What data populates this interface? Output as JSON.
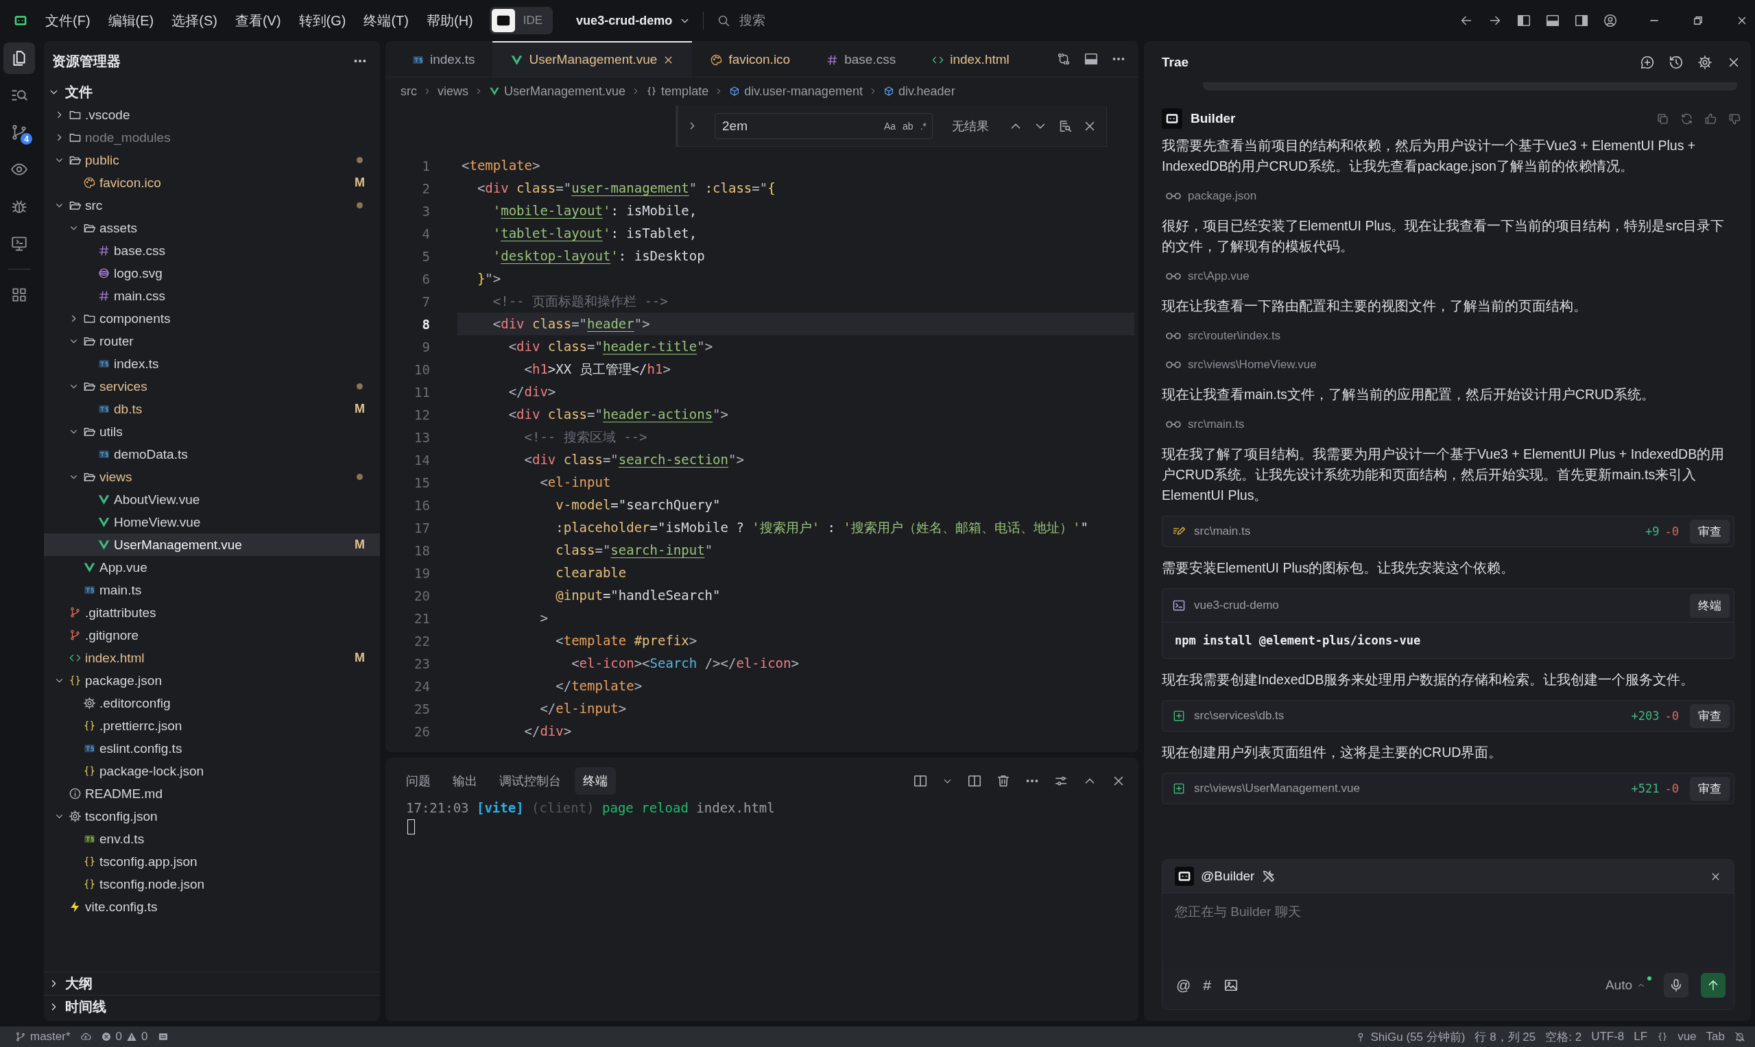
{
  "title_bar": {
    "menus": [
      "文件(F)",
      "编辑(E)",
      "选择(S)",
      "查看(V)",
      "转到(G)",
      "终端(T)",
      "帮助(H)"
    ],
    "mode_switch": [
      {
        "kind": "builder",
        "selected": true
      },
      {
        "kind": "text",
        "label": "IDE",
        "selected": false
      }
    ],
    "project": "vue3-crud-demo",
    "search": {
      "placeholder": "搜索"
    }
  },
  "activity_bar": {
    "items": [
      {
        "kind": "files",
        "selected": true
      },
      {
        "kind": "search",
        "selected": false
      },
      {
        "kind": "source-control",
        "selected": false,
        "badge": "4"
      },
      {
        "kind": "eye",
        "selected": false
      },
      {
        "kind": "debug",
        "selected": false
      },
      {
        "kind": "remote",
        "selected": false
      }
    ],
    "extensions": [
      {
        "kind": "extensions",
        "selected": false
      }
    ]
  },
  "explorer": {
    "title": "资源管理器",
    "section": {
      "title": "文件",
      "expanded": true
    },
    "tree": [
      {
        "name": ".vscode",
        "kind": "folder",
        "expanded": false,
        "selected": false
      },
      {
        "name": "node_modules",
        "kind": "folder",
        "expanded": false,
        "selected": false,
        "ignored": true
      },
      {
        "name": "public",
        "kind": "folder",
        "expanded": true,
        "selected": false,
        "modified": true,
        "changed": true,
        "children": [
          {
            "name": "favicon.ico",
            "kind": "image",
            "selected": false,
            "modified": true,
            "status": "M"
          }
        ]
      },
      {
        "name": "src",
        "kind": "folder",
        "expanded": true,
        "selected": false,
        "changed": true,
        "children": [
          {
            "name": "assets",
            "kind": "folder",
            "expanded": true,
            "selected": false,
            "children": [
              {
                "name": "base.css",
                "kind": "css",
                "selected": false
              },
              {
                "name": "logo.svg",
                "kind": "svg",
                "selected": false
              },
              {
                "name": "main.css",
                "kind": "css",
                "selected": false
              }
            ]
          },
          {
            "name": "components",
            "kind": "folder",
            "expanded": false,
            "selected": false
          },
          {
            "name": "router",
            "kind": "folder",
            "expanded": true,
            "selected": false,
            "children": [
              {
                "name": "index.ts",
                "kind": "ts",
                "selected": false
              }
            ]
          },
          {
            "name": "services",
            "kind": "folder",
            "expanded": true,
            "selected": false,
            "modified": true,
            "changed": true,
            "children": [
              {
                "name": "db.ts",
                "kind": "ts",
                "selected": false,
                "modified": true,
                "status": "M"
              }
            ]
          },
          {
            "name": "utils",
            "kind": "folder",
            "expanded": true,
            "selected": false,
            "children": [
              {
                "name": "demoData.ts",
                "kind": "ts",
                "selected": false
              }
            ]
          },
          {
            "name": "views",
            "kind": "folder",
            "expanded": true,
            "selected": false,
            "modified": true,
            "changed": true,
            "children": [
              {
                "name": "AboutView.vue",
                "kind": "vue",
                "selected": false
              },
              {
                "name": "HomeView.vue",
                "kind": "vue",
                "selected": false
              },
              {
                "name": "UserManagement.vue",
                "kind": "vue",
                "selected": true,
                "modified": true,
                "status": "M"
              }
            ]
          },
          {
            "name": "App.vue",
            "kind": "vue",
            "selected": false
          },
          {
            "name": "main.ts",
            "kind": "ts",
            "selected": false
          }
        ]
      },
      {
        "name": ".gitattributes",
        "kind": "git",
        "selected": false
      },
      {
        "name": ".gitignore",
        "kind": "git",
        "selected": false
      },
      {
        "name": "index.html",
        "kind": "html",
        "selected": false,
        "modified": true,
        "status": "M"
      },
      {
        "name": "package.json",
        "kind": "json",
        "expanded": true,
        "selected": false,
        "children": [
          {
            "name": ".editorconfig",
            "kind": "gear",
            "selected": false
          },
          {
            "name": ".prettierrc.json",
            "kind": "json",
            "selected": false
          },
          {
            "name": "eslint.config.ts",
            "kind": "ts",
            "selected": false
          },
          {
            "name": "package-lock.json",
            "kind": "json",
            "selected": false
          }
        ]
      },
      {
        "name": "README.md",
        "kind": "info",
        "selected": false
      },
      {
        "name": "tsconfig.json",
        "kind": "gear",
        "expanded": true,
        "selected": false,
        "children": [
          {
            "name": "env.d.ts",
            "kind": "dts",
            "selected": false
          },
          {
            "name": "tsconfig.app.json",
            "kind": "json",
            "selected": false
          },
          {
            "name": "tsconfig.node.json",
            "kind": "json",
            "selected": false
          }
        ]
      },
      {
        "name": "vite.config.ts",
        "kind": "bolt",
        "selected": false
      }
    ],
    "collapsed_sections": [
      {
        "title": "大纲",
        "expanded": false
      },
      {
        "title": "时间线",
        "expanded": false
      }
    ]
  },
  "editor": {
    "tabs": [
      {
        "label": "index.ts",
        "kind": "ts",
        "modified": false,
        "selected": false
      },
      {
        "label": "UserManagement.vue",
        "kind": "vue",
        "modified": true,
        "selected": true
      },
      {
        "label": "favicon.ico",
        "kind": "image",
        "modified": true,
        "selected": false
      },
      {
        "label": "base.css",
        "kind": "css",
        "modified": false,
        "selected": false
      },
      {
        "label": "index.html",
        "kind": "html",
        "modified": true,
        "selected": false
      }
    ],
    "breadcrumb": [
      {
        "label": "src",
        "kind": "plain"
      },
      {
        "label": "views",
        "kind": "plain"
      },
      {
        "label": "UserManagement.vue",
        "kind": "vue"
      },
      {
        "label": "template",
        "kind": "braces"
      },
      {
        "label": "div.user-management",
        "kind": "element"
      },
      {
        "label": "div.header",
        "kind": "element"
      }
    ],
    "find": {
      "value": "2em",
      "options": [
        "Aa",
        "ab",
        ".*"
      ],
      "result": "无结果"
    },
    "lines": [
      {
        "n": "1",
        "current": false,
        "code": [
          {
            "text": "<",
            "kind": "p"
          },
          {
            "text": "template",
            "kind": "tag2"
          },
          {
            "text": ">",
            "kind": "p"
          }
        ]
      },
      {
        "n": "2",
        "current": false,
        "code": [
          {
            "text": "  <",
            "kind": "p"
          },
          {
            "text": "div",
            "kind": "tag"
          },
          {
            "text": " class",
            "kind": "attr"
          },
          {
            "text": "=\"",
            "kind": "p"
          },
          {
            "text": "user-management",
            "kind": "link"
          },
          {
            "text": "\" ",
            "kind": "p"
          },
          {
            "text": ":class",
            "kind": "attr"
          },
          {
            "text": "=\"",
            "kind": "p"
          },
          {
            "text": "{",
            "kind": "brace"
          }
        ]
      },
      {
        "n": "3",
        "current": false,
        "code": [
          {
            "text": "    '",
            "kind": "str"
          },
          {
            "text": "mobile-layout",
            "kind": "link"
          },
          {
            "text": "'",
            "kind": "str"
          },
          {
            "text": ": isMobile,",
            "kind": "plain"
          }
        ]
      },
      {
        "n": "4",
        "current": false,
        "code": [
          {
            "text": "    '",
            "kind": "str"
          },
          {
            "text": "tablet-layout",
            "kind": "link"
          },
          {
            "text": "'",
            "kind": "str"
          },
          {
            "text": ": isTablet,",
            "kind": "plain"
          }
        ]
      },
      {
        "n": "5",
        "current": false,
        "code": [
          {
            "text": "    '",
            "kind": "str"
          },
          {
            "text": "desktop-layout",
            "kind": "link"
          },
          {
            "text": "'",
            "kind": "str"
          },
          {
            "text": ": isDesktop",
            "kind": "plain"
          }
        ]
      },
      {
        "n": "6",
        "current": false,
        "code": [
          {
            "text": "  }",
            "kind": "brace"
          },
          {
            "text": "\">",
            "kind": "p"
          }
        ]
      },
      {
        "n": "7",
        "current": false,
        "code": [
          {
            "text": "    <!-- 页面标题和操作栏 -->",
            "kind": "comment"
          }
        ]
      },
      {
        "n": "8",
        "current": true,
        "code": [
          {
            "text": "    <",
            "kind": "p"
          },
          {
            "text": "div",
            "kind": "tag"
          },
          {
            "text": " class",
            "kind": "attr"
          },
          {
            "text": "=\"",
            "kind": "p"
          },
          {
            "text": "header",
            "kind": "link"
          },
          {
            "text": "\">",
            "kind": "p"
          }
        ]
      },
      {
        "n": "9",
        "current": false,
        "code": [
          {
            "text": "      <",
            "kind": "p"
          },
          {
            "text": "div",
            "kind": "tag"
          },
          {
            "text": " class",
            "kind": "attr"
          },
          {
            "text": "=\"",
            "kind": "p"
          },
          {
            "text": "header-title",
            "kind": "link"
          },
          {
            "text": "\">",
            "kind": "p"
          }
        ]
      },
      {
        "n": "10",
        "current": false,
        "code": [
          {
            "text": "        <",
            "kind": "p"
          },
          {
            "text": "h1",
            "kind": "tag"
          },
          {
            "text": ">XX 员工管理</",
            "kind": "plain"
          },
          {
            "text": "h1",
            "kind": "tag"
          },
          {
            "text": ">",
            "kind": "p"
          }
        ]
      },
      {
        "n": "11",
        "current": false,
        "code": [
          {
            "text": "      </",
            "kind": "p"
          },
          {
            "text": "div",
            "kind": "tag"
          },
          {
            "text": ">",
            "kind": "p"
          }
        ]
      },
      {
        "n": "12",
        "current": false,
        "code": [
          {
            "text": "      <",
            "kind": "p"
          },
          {
            "text": "div",
            "kind": "tag"
          },
          {
            "text": " class",
            "kind": "attr"
          },
          {
            "text": "=\"",
            "kind": "p"
          },
          {
            "text": "header-actions",
            "kind": "link"
          },
          {
            "text": "\">",
            "kind": "p"
          }
        ]
      },
      {
        "n": "13",
        "current": false,
        "code": [
          {
            "text": "        <!-- 搜索区域 -->",
            "kind": "comment"
          }
        ]
      },
      {
        "n": "14",
        "current": false,
        "code": [
          {
            "text": "        <",
            "kind": "p"
          },
          {
            "text": "div",
            "kind": "tag"
          },
          {
            "text": " class",
            "kind": "attr"
          },
          {
            "text": "=\"",
            "kind": "p"
          },
          {
            "text": "search-section",
            "kind": "link"
          },
          {
            "text": "\">",
            "kind": "p"
          }
        ]
      },
      {
        "n": "15",
        "current": false,
        "code": [
          {
            "text": "          <",
            "kind": "p"
          },
          {
            "text": "el-input",
            "kind": "tag2"
          }
        ]
      },
      {
        "n": "16",
        "current": false,
        "code": [
          {
            "text": "            v-model",
            "kind": "attr"
          },
          {
            "text": "=\"searchQuery\"",
            "kind": "plain"
          }
        ]
      },
      {
        "n": "17",
        "current": false,
        "code": [
          {
            "text": "            :placeholder",
            "kind": "attr"
          },
          {
            "text": "=\"isMobile ? ",
            "kind": "plain"
          },
          {
            "text": "'搜索用户'",
            "kind": "str"
          },
          {
            "text": " : ",
            "kind": "plain"
          },
          {
            "text": "'搜索用户（姓名、邮箱、电话、地址）'",
            "kind": "str"
          },
          {
            "text": "\"",
            "kind": "plain"
          }
        ]
      },
      {
        "n": "18",
        "current": false,
        "code": [
          {
            "text": "            class",
            "kind": "attr"
          },
          {
            "text": "=\"",
            "kind": "p"
          },
          {
            "text": "search-input",
            "kind": "link"
          },
          {
            "text": "\"",
            "kind": "p"
          }
        ]
      },
      {
        "n": "19",
        "current": false,
        "code": [
          {
            "text": "            clearable",
            "kind": "attr"
          }
        ]
      },
      {
        "n": "20",
        "current": false,
        "code": [
          {
            "text": "            @input",
            "kind": "attr"
          },
          {
            "text": "=\"handleSearch\"",
            "kind": "plain"
          }
        ]
      },
      {
        "n": "21",
        "current": false,
        "code": [
          {
            "text": "          >",
            "kind": "p"
          }
        ]
      },
      {
        "n": "22",
        "current": false,
        "code": [
          {
            "text": "            <",
            "kind": "p"
          },
          {
            "text": "template",
            "kind": "tag2"
          },
          {
            "text": " #prefix",
            "kind": "attr"
          },
          {
            "text": ">",
            "kind": "p"
          }
        ]
      },
      {
        "n": "23",
        "current": false,
        "code": [
          {
            "text": "              <",
            "kind": "p"
          },
          {
            "text": "el-icon",
            "kind": "tag"
          },
          {
            "text": "><",
            "kind": "p"
          },
          {
            "text": "Search",
            "kind": "comp"
          },
          {
            "text": " /></",
            "kind": "p"
          },
          {
            "text": "el-icon",
            "kind": "tag"
          },
          {
            "text": ">",
            "kind": "p"
          }
        ]
      },
      {
        "n": "24",
        "current": false,
        "code": [
          {
            "text": "            </",
            "kind": "p"
          },
          {
            "text": "template",
            "kind": "tag2"
          },
          {
            "text": ">",
            "kind": "p"
          }
        ]
      },
      {
        "n": "25",
        "current": false,
        "code": [
          {
            "text": "          </",
            "kind": "p"
          },
          {
            "text": "el-input",
            "kind": "tag2"
          },
          {
            "text": ">",
            "kind": "p"
          }
        ]
      },
      {
        "n": "26",
        "current": false,
        "code": [
          {
            "text": "        </",
            "kind": "p"
          },
          {
            "text": "div",
            "kind": "tag"
          },
          {
            "text": ">",
            "kind": "p"
          }
        ]
      }
    ]
  },
  "terminal": {
    "tabs": [
      {
        "label": "问题",
        "selected": false
      },
      {
        "label": "输出",
        "selected": false
      },
      {
        "label": "调试控制台",
        "selected": false
      },
      {
        "label": "终端",
        "selected": true
      }
    ],
    "output": [
      {
        "text": "17:21:03",
        "kind": "time"
      },
      {
        "text": "[vite]",
        "kind": "source"
      },
      {
        "text": "(client)",
        "kind": "muted"
      },
      {
        "text": "page reload",
        "kind": "action"
      },
      {
        "text": "index.html",
        "kind": "plain"
      }
    ]
  },
  "assistant": {
    "title": "Trae",
    "agent": "Builder",
    "messages": [
      {
        "kind": "text",
        "text": "我需要先查看当前项目的结构和依赖，然后为用户设计一个基于Vue3 + ElementUI Plus + IndexedDB的用户CRUD系统。让我先查看package.json了解当前的依赖情况。"
      },
      {
        "kind": "read",
        "path": "package.json"
      },
      {
        "kind": "text",
        "text": "很好，项目已经安装了ElementUI Plus。现在让我查看一下当前的项目结构，特别是src目录下的文件，了解现有的模板代码。"
      },
      {
        "kind": "read",
        "path": "src\\App.vue"
      },
      {
        "kind": "text",
        "text": "现在让我查看一下路由配置和主要的视图文件，了解当前的页面结构。"
      },
      {
        "kind": "read",
        "path": "src\\router\\index.ts"
      },
      {
        "kind": "read",
        "path": "src\\views\\HomeView.vue"
      },
      {
        "kind": "text",
        "text": "现在让我查看main.ts文件，了解当前的应用配置，然后开始设计用户CRUD系统。"
      },
      {
        "kind": "read",
        "path": "src\\main.ts"
      },
      {
        "kind": "text",
        "text": "现在我了解了项目结构。我需要为用户设计一个基于Vue3 + ElementUI Plus + IndexedDB的用户CRUD系统。让我先设计系统功能和页面结构，然后开始实现。首先更新main.ts来引入ElementUI Plus。"
      },
      {
        "kind": "edit-file",
        "path": "src\\main.ts",
        "added": "+9",
        "removed": "-0",
        "button": "审查"
      },
      {
        "kind": "text",
        "text": "需要安装ElementUI Plus的图标包。让我先安装这个依赖。"
      },
      {
        "kind": "terminal",
        "title": "vue3-crud-demo",
        "button": "终端",
        "command": "npm install @element-plus/icons-vue"
      },
      {
        "kind": "text",
        "text": "现在我需要创建IndexedDB服务来处理用户数据的存储和检索。让我创建一个服务文件。"
      },
      {
        "kind": "create-file",
        "path": "src\\services\\db.ts",
        "added": "+203",
        "removed": "-0",
        "button": "审查"
      },
      {
        "kind": "text",
        "text": "现在创建用户列表页面组件，这将是主要的CRUD界面。"
      },
      {
        "kind": "create-file",
        "path": "src\\views\\UserManagement.vue",
        "added": "+521",
        "removed": "-0",
        "button": "审查"
      }
    ],
    "input": {
      "agent": "@Builder",
      "placeholder": "您正在与 Builder 聊天",
      "actions": [
        "@",
        "#"
      ],
      "model": "Auto"
    }
  },
  "status_bar": {
    "branch": "master*",
    "errors": "0",
    "warnings": "0",
    "right": [
      {
        "kind": "blame",
        "text": "ShiGu (55 分钟前)"
      },
      {
        "kind": "text",
        "text": "行 8，列 25"
      },
      {
        "kind": "text",
        "text": "空格: 2"
      },
      {
        "kind": "text",
        "text": "UTF-8"
      },
      {
        "kind": "text",
        "text": "LF"
      },
      {
        "kind": "braces"
      },
      {
        "kind": "text",
        "text": "vue"
      },
      {
        "kind": "text",
        "text": "Tab"
      },
      {
        "kind": "bell"
      }
    ]
  }
}
